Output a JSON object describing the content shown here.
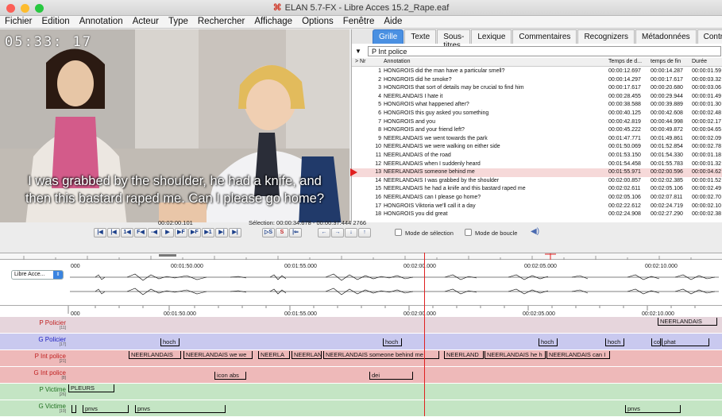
{
  "window": {
    "title": "ELAN 5.7-FX - Libre Acces 15.2_Rape.eaf",
    "app_icon": "elan-icon"
  },
  "menu": [
    "Fichier",
    "Edition",
    "Annotation",
    "Acteur",
    "Type",
    "Rechercher",
    "Affichage",
    "Options",
    "Fenêtre",
    "Aide"
  ],
  "video": {
    "timecode": "05:33: 17",
    "subtitle_line1": "I was grabbed by the shoulder, he had a knife, and",
    "subtitle_line2": "then this bastard raped me. Can I please go home?"
  },
  "tabs": [
    "Grille",
    "Texte",
    "Sous-titres",
    "Lexique",
    "Commentaires",
    "Recognizers",
    "Métadonnées",
    "Contrôles"
  ],
  "active_tab": "Grille",
  "grid": {
    "tier": "P Int police",
    "headers": {
      "nr": "> Nr",
      "annotation": "Annotation",
      "begin": "Temps de d...",
      "end": "temps de fin",
      "duration": "Durée"
    },
    "rows": [
      {
        "nr": "1",
        "text": "HONGROIS did the man have a particular smell?",
        "begin": "00:00:12.697",
        "end": "00:00:14.287",
        "dur": "00:00:01.59"
      },
      {
        "nr": "2",
        "text": "HONGROIS did he smoke?",
        "begin": "00:00:14.297",
        "end": "00:00:17.617",
        "dur": "00:00:03.32"
      },
      {
        "nr": "3",
        "text": "HONGROIS that sort of details may be crucial to find him",
        "begin": "00:00:17.617",
        "end": "00:00:20.680",
        "dur": "00:00:03.06"
      },
      {
        "nr": "4",
        "text": "NEERLANDAIS I hate it",
        "begin": "00:00:28.455",
        "end": "00:00:29.944",
        "dur": "00:00:01.49"
      },
      {
        "nr": "5",
        "text": "HONGROIS what happened after?",
        "begin": "00:00:38.588",
        "end": "00:00:39.889",
        "dur": "00:00:01.30"
      },
      {
        "nr": "6",
        "text": "HONGROIS this guy asked you something",
        "begin": "00:00:40.125",
        "end": "00:00:42.608",
        "dur": "00:00:02.48"
      },
      {
        "nr": "7",
        "text": "HONGROIS and you",
        "begin": "00:00:42.819",
        "end": "00:00:44.998",
        "dur": "00:00:02.17"
      },
      {
        "nr": "8",
        "text": "HONGROIS and your friend left?",
        "begin": "00:00:45.222",
        "end": "00:00:49.872",
        "dur": "00:00:04.65"
      },
      {
        "nr": "9",
        "text": "NEERLANDAIS we went towards the park",
        "begin": "00:01:47.771",
        "end": "00:01:49.861",
        "dur": "00:00:02.09"
      },
      {
        "nr": "10",
        "text": "NEERLANDAIS we were walking on either side",
        "begin": "00:01:50.069",
        "end": "00:01:52.854",
        "dur": "00:00:02.78"
      },
      {
        "nr": "11",
        "text": "NEERLANDAIS of the road",
        "begin": "00:01:53.150",
        "end": "00:01:54.330",
        "dur": "00:00:01.18"
      },
      {
        "nr": "12",
        "text": "NEERLANDAIS when I suddenly heard",
        "begin": "00:01:54.458",
        "end": "00:01:55.783",
        "dur": "00:00:01.32"
      },
      {
        "nr": "13",
        "text": "NEERLANDAIS someone behind me",
        "begin": "00:01:55.971",
        "end": "00:02:00.596",
        "dur": "00:00:04.62"
      },
      {
        "nr": "14",
        "text": "NEERLANDAIS I was grabbed by the shoulder",
        "begin": "00:02:00.857",
        "end": "00:02:02.385",
        "dur": "00:00:01.52"
      },
      {
        "nr": "15",
        "text": "NEERLANDAIS he had a knife and this bastard raped me",
        "begin": "00:02:02.611",
        "end": "00:02:05.106",
        "dur": "00:00:02.49"
      },
      {
        "nr": "16",
        "text": "NEERLANDAIS can I please go home?",
        "begin": "00:02:05.106",
        "end": "00:02:07.811",
        "dur": "00:00:02.70"
      },
      {
        "nr": "17",
        "text": "HONGROIS Viktoria we'll call it a day",
        "begin": "00:02:22.612",
        "end": "00:02:24.719",
        "dur": "00:00:02.10"
      },
      {
        "nr": "18",
        "text": "HONGROIS you did great",
        "begin": "00:02:24.908",
        "end": "00:02:27.290",
        "dur": "00:00:02.38"
      }
    ],
    "selected_row": 12
  },
  "player": {
    "current_time": "00:02:00.101",
    "selection": "Sélection: 00:00:34.678 - 00:00:37.444  2766",
    "buttons": [
      "|◀",
      "|◀",
      "1◀",
      "F◀",
      "-◀",
      "▶",
      "▶F",
      "▶F",
      "▶1",
      "▶|",
      "▶|"
    ],
    "sel_buttons": [
      "▷S",
      "S",
      "|⇐"
    ],
    "nav_buttons": [
      "←",
      "→",
      "↓",
      "↑"
    ],
    "mode_selection": "Mode de sélection",
    "mode_loop": "Mode de boucle",
    "speaker_icon": "speaker-icon"
  },
  "waveform": {
    "source": "Libre Acce...",
    "ticks": [
      "000",
      "00:01:50.000",
      "00:01:55.000",
      "00:02:00.000",
      "00:02:05.000",
      "00:02:10.000"
    ]
  },
  "timeline": {
    "ticks": [
      "000",
      "00:01:50.000",
      "00:01:55.000",
      "00:02:00.000",
      "00:02:05.000",
      "00:02:10.000"
    ],
    "tiers": [
      {
        "name": "P Policier",
        "count": "[11]",
        "color": "#e6d5dc",
        "label_color": "#c02020",
        "anns": [
          {
            "text": "NEERLANDAIS",
            "cls": "a1"
          }
        ]
      },
      {
        "name": "G Policier",
        "count": "[17]",
        "color": "#c9c9ef",
        "label_color": "#2020c0",
        "anns": [
          {
            "text": "hoch",
            "cls": "a2"
          },
          {
            "text": "hoch",
            "cls": "a3"
          },
          {
            "text": "hoch",
            "cls": "a4"
          },
          {
            "text": "hoch",
            "cls": "a5"
          },
          {
            "text": "co",
            "cls": "a6"
          },
          {
            "text": "phat",
            "cls": "a7"
          }
        ]
      },
      {
        "name": "P Int police",
        "count": "[21]",
        "color": "#eeb9b9",
        "label_color": "#c02020",
        "anns": [
          {
            "text": "NEERLANDAIS",
            "cls": "a8"
          },
          {
            "text": "NEERLANDAIS we we",
            "cls": "a9"
          },
          {
            "text": "NEERLA",
            "cls": "a10"
          },
          {
            "text": "NEERLAN",
            "cls": "a11"
          },
          {
            "text": "NEERLANDAIS someone behind me",
            "cls": "a12"
          },
          {
            "text": "NEERLAND",
            "cls": "a13"
          },
          {
            "text": "NEERLANDAIS he h",
            "cls": "a14"
          },
          {
            "text": "NEERLANDAIS can I",
            "cls": "a15"
          }
        ]
      },
      {
        "name": "G Int police",
        "count": "[8]",
        "color": "#eeb9b9",
        "label_color": "#c02020",
        "anns": [
          {
            "text": "icon abs",
            "cls": "a16"
          },
          {
            "text": "dei",
            "cls": "a17"
          }
        ]
      },
      {
        "name": "P Victime",
        "count": "[26]",
        "color": "#c4e5c4",
        "label_color": "#207020",
        "anns": [
          {
            "text": "PLEURS",
            "cls": "a18"
          }
        ]
      },
      {
        "name": "G Victime",
        "count": "[19]",
        "color": "#c4e5c4",
        "label_color": "#207020",
        "anns": [
          {
            "text": "",
            "cls": "a19"
          },
          {
            "text": "pnvs",
            "cls": "a20"
          },
          {
            "text": "pnvs",
            "cls": "a21"
          },
          {
            "text": "pnvs",
            "cls": "a22"
          }
        ]
      }
    ]
  }
}
